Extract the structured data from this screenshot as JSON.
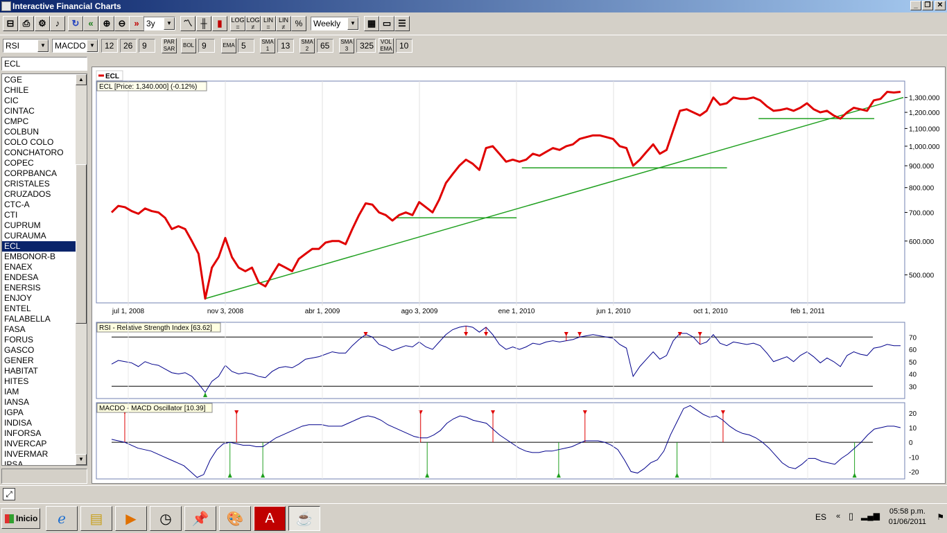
{
  "window": {
    "title": "Interactive Financial Charts"
  },
  "toolbar1": {
    "period": "3y",
    "interval": "Weekly"
  },
  "toolbar2": {
    "indicator1": "RSI",
    "indicator2": "MACDO",
    "macd_fast": "12",
    "macd_slow": "26",
    "macd_signal": "9",
    "par_label": "PAR\nSAR",
    "bol_label": "BOL",
    "bol_value": "9",
    "ema_label": "EMA",
    "ema_value": "5",
    "sma1_label": "SMA\n1",
    "sma1_value": "13",
    "sma2_label": "SMA\n2",
    "sma2_value": "65",
    "sma3_label": "SMA\n3",
    "sma3_value": "325",
    "volema_label": "VOL\nEMA",
    "volema_value": "10"
  },
  "symbol": {
    "current": "ECL"
  },
  "symbols": [
    "CGE",
    "CHILE",
    "CIC",
    "CINTAC",
    "CMPC",
    "COLBUN",
    "COLO COLO",
    "CONCHATORO",
    "COPEC",
    "CORPBANCA",
    "CRISTALES",
    "CRUZADOS",
    "CTC-A",
    "CTI",
    "CUPRUM",
    "CURAUMA",
    "ECL",
    "EMBONOR-B",
    "ENAEX",
    "ENDESA",
    "ENERSIS",
    "ENJOY",
    "ENTEL",
    "FALABELLA",
    "FASA",
    "FORUS",
    "GASCO",
    "GENER",
    "HABITAT",
    "HITES",
    "IAM",
    "IANSA",
    "IGPA",
    "INDISA",
    "INFORSA",
    "INVERCAP",
    "INVERMAR",
    "IPSA"
  ],
  "selected_symbol": "ECL",
  "taskbar": {
    "start_label": "Inicio",
    "language": "ES",
    "time": "05:58 p.m.",
    "date": "01/06/2011"
  },
  "colors": {
    "price": "#e00000",
    "trend": "#20a020",
    "indicator": "#00008b",
    "titlebar": "#0a246a"
  },
  "chart_data": [
    {
      "type": "line",
      "legend": "ECL",
      "title": "ECL [Price: 1,340.000] (-0.12%)",
      "x_ticks": [
        "jul 1, 2008",
        "nov 3, 2008",
        "abr 1, 2009",
        "ago 3, 2009",
        "ene 1, 2010",
        "jun 1, 2010",
        "oct 1, 2010",
        "feb 1, 2011"
      ],
      "y_ticks": [
        "1,300.000",
        "1,200.000",
        "1,100.000",
        "1,000.000",
        "900.000",
        "800.000",
        "700.000",
        "600.000",
        "500.000"
      ],
      "y_scale": "log",
      "ylim": [
        430,
        1420
      ],
      "series": [
        {
          "values": [
            700,
            725,
            720,
            705,
            695,
            715,
            705,
            700,
            680,
            640,
            650,
            640,
            600,
            560,
            440,
            520,
            550,
            610,
            550,
            520,
            510,
            520,
            480,
            470,
            500,
            530,
            520,
            510,
            545,
            560,
            575,
            575,
            595,
            600,
            600,
            590,
            640,
            690,
            735,
            730,
            700,
            690,
            670,
            690,
            700,
            690,
            740,
            720,
            700,
            750,
            820,
            860,
            900,
            930,
            910,
            880,
            990,
            1000,
            960,
            920,
            930,
            920,
            930,
            960,
            950,
            970,
            990,
            980,
            1000,
            1010,
            1040,
            1050,
            1060,
            1060,
            1050,
            1040,
            1000,
            990,
            900,
            930,
            970,
            1010,
            960,
            980,
            1090,
            1210,
            1220,
            1200,
            1180,
            1210,
            1300,
            1250,
            1260,
            1300,
            1290,
            1290,
            1300,
            1280,
            1240,
            1210,
            1215,
            1225,
            1210,
            1230,
            1260,
            1220,
            1200,
            1210,
            1180,
            1160,
            1200,
            1230,
            1220,
            1210,
            1280,
            1290,
            1340,
            1335,
            1340
          ]
        }
      ],
      "support_lines_price": [
        680,
        890,
        1160
      ]
    },
    {
      "type": "line",
      "title": "RSI - Relative Strength Index [63.62]",
      "y_ticks": [
        "70",
        "60",
        "50",
        "40",
        "30"
      ],
      "ylim": [
        20,
        82
      ],
      "reference_lines": [
        70,
        30
      ],
      "series": [
        {
          "values": [
            48,
            51,
            50,
            49,
            46,
            50,
            48,
            47,
            44,
            41,
            40,
            41,
            38,
            32,
            25,
            34,
            38,
            47,
            42,
            40,
            41,
            40,
            38,
            37,
            42,
            45,
            46,
            45,
            48,
            52,
            53,
            54,
            56,
            58,
            57,
            57,
            63,
            68,
            72,
            70,
            64,
            62,
            59,
            61,
            63,
            62,
            66,
            62,
            60,
            66,
            72,
            76,
            78,
            79,
            78,
            74,
            78,
            72,
            64,
            60,
            62,
            60,
            62,
            65,
            64,
            66,
            67,
            66,
            67,
            68,
            70,
            71,
            72,
            71,
            70,
            69,
            64,
            61,
            38,
            46,
            52,
            58,
            52,
            55,
            67,
            73,
            73,
            70,
            64,
            66,
            72,
            65,
            63,
            66,
            65,
            64,
            65,
            63,
            57,
            50,
            52,
            54,
            50,
            55,
            58,
            54,
            49,
            53,
            50,
            46,
            55,
            58,
            56,
            55,
            61,
            62,
            64,
            63,
            63
          ]
        }
      ],
      "sell_signals": 8,
      "buy_signals": 1
    },
    {
      "type": "line",
      "title": "MACDO - MACD Oscillator [10.39]",
      "y_ticks": [
        "20",
        "10",
        "0",
        "-10",
        "-20"
      ],
      "ylim": [
        -25,
        27
      ],
      "reference_lines": [
        0
      ],
      "series": [
        {
          "values": [
            2,
            1,
            0,
            -2,
            -4,
            -5,
            -6,
            -8,
            -10,
            -12,
            -14,
            -16,
            -20,
            -24,
            -22,
            -12,
            -5,
            -1,
            0,
            -1,
            -2,
            -2,
            -3,
            -3,
            0,
            3,
            5,
            7,
            9,
            11,
            12,
            12,
            12,
            11,
            11,
            11,
            13,
            15,
            17,
            18,
            17,
            15,
            12,
            10,
            8,
            6,
            4,
            3,
            3,
            5,
            8,
            13,
            16,
            18,
            17,
            15,
            14,
            13,
            9,
            5,
            2,
            -1,
            -4,
            -6,
            -7,
            -7,
            -6,
            -6,
            -5,
            -4,
            -3,
            -1,
            1,
            1,
            1,
            0,
            -2,
            -5,
            -12,
            -20,
            -21,
            -18,
            -14,
            -12,
            -6,
            5,
            14,
            23,
            25,
            22,
            19,
            17,
            18,
            15,
            11,
            8,
            6,
            5,
            3,
            0,
            -4,
            -9,
            -14,
            -17,
            -18,
            -15,
            -11,
            -11,
            -13,
            -14,
            -15,
            -11,
            -8,
            -4,
            0,
            5,
            9,
            10,
            11,
            11,
            10
          ]
        }
      ],
      "sell_signals": 7,
      "buy_signals": 6
    }
  ]
}
